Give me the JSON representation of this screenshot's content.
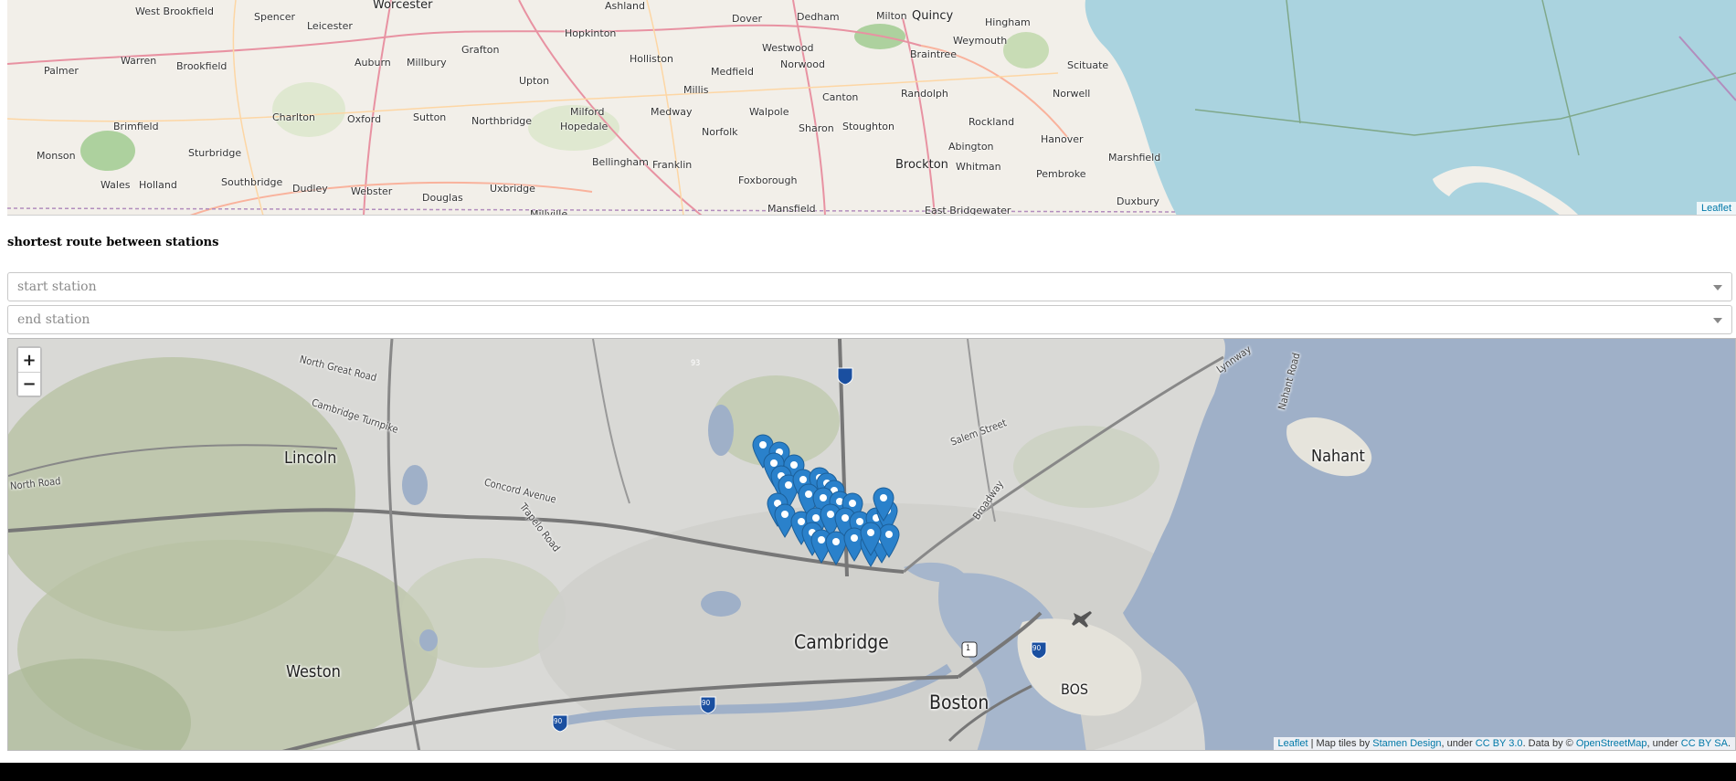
{
  "top_map": {
    "places": [
      {
        "name": "West Brookfield",
        "big": false
      },
      {
        "name": "Spencer",
        "big": false
      },
      {
        "name": "Leicester",
        "big": false
      },
      {
        "name": "Worcester",
        "big": true
      },
      {
        "name": "Ashland",
        "big": false
      },
      {
        "name": "Dover",
        "big": false
      },
      {
        "name": "Dedham",
        "big": false
      },
      {
        "name": "Milton",
        "big": false
      },
      {
        "name": "Quincy",
        "big": true
      },
      {
        "name": "Hingham",
        "big": false
      },
      {
        "name": "Palmer",
        "big": false
      },
      {
        "name": "Warren",
        "big": false
      },
      {
        "name": "Brookfield",
        "big": false
      },
      {
        "name": "Auburn",
        "big": false
      },
      {
        "name": "Millbury",
        "big": false
      },
      {
        "name": "Grafton",
        "big": false
      },
      {
        "name": "Hopkinton",
        "big": false
      },
      {
        "name": "Holliston",
        "big": false
      },
      {
        "name": "Medfield",
        "big": false
      },
      {
        "name": "Westwood",
        "big": false
      },
      {
        "name": "Norwood",
        "big": false
      },
      {
        "name": "Braintree",
        "big": false
      },
      {
        "name": "Weymouth",
        "big": false
      },
      {
        "name": "Scituate",
        "big": false
      },
      {
        "name": "Upton",
        "big": false
      },
      {
        "name": "Millis",
        "big": false
      },
      {
        "name": "Canton",
        "big": false
      },
      {
        "name": "Randolph",
        "big": false
      },
      {
        "name": "Norwell",
        "big": false
      },
      {
        "name": "Charlton",
        "big": false
      },
      {
        "name": "Oxford",
        "big": false
      },
      {
        "name": "Sutton",
        "big": false
      },
      {
        "name": "Northbridge",
        "big": false
      },
      {
        "name": "Hopedale",
        "big": false
      },
      {
        "name": "Milford",
        "big": false
      },
      {
        "name": "Medway",
        "big": false
      },
      {
        "name": "Walpole",
        "big": false
      },
      {
        "name": "Rockland",
        "big": false
      },
      {
        "name": "Monson",
        "big": false
      },
      {
        "name": "Brimfield",
        "big": false
      },
      {
        "name": "Sturbridge",
        "big": false
      },
      {
        "name": "Norfolk",
        "big": false
      },
      {
        "name": "Sharon",
        "big": false
      },
      {
        "name": "Stoughton",
        "big": false
      },
      {
        "name": "Abington",
        "big": false
      },
      {
        "name": "Hanover",
        "big": false
      },
      {
        "name": "Marshfield",
        "big": false
      },
      {
        "name": "Bellingham",
        "big": false
      },
      {
        "name": "Franklin",
        "big": false
      },
      {
        "name": "Brockton",
        "big": true
      },
      {
        "name": "Whitman",
        "big": false
      },
      {
        "name": "Wales",
        "big": false
      },
      {
        "name": "Holland",
        "big": false
      },
      {
        "name": "Southbridge",
        "big": false
      },
      {
        "name": "Dudley",
        "big": false
      },
      {
        "name": "Webster",
        "big": false
      },
      {
        "name": "Douglas",
        "big": false
      },
      {
        "name": "Uxbridge",
        "big": false
      },
      {
        "name": "Foxborough",
        "big": false
      },
      {
        "name": "Pembroke",
        "big": false
      },
      {
        "name": "Duxbury",
        "big": false
      },
      {
        "name": "Mansfield",
        "big": false
      },
      {
        "name": "East Bridgewater",
        "big": false
      },
      {
        "name": "Millville",
        "big": false
      }
    ],
    "attribution_link": "Leaflet"
  },
  "page": {
    "title": "shortest route between stations"
  },
  "inputs": {
    "start_placeholder": "start station",
    "end_placeholder": "end station"
  },
  "bottom_map": {
    "zoom_in": "+",
    "zoom_out": "−",
    "labels": [
      {
        "name": "Lincoln",
        "kind": "town"
      },
      {
        "name": "Weston",
        "kind": "town"
      },
      {
        "name": "Nahant",
        "kind": "town"
      },
      {
        "name": "Cambridge",
        "kind": "city"
      },
      {
        "name": "Boston",
        "kind": "city"
      },
      {
        "name": "BOS",
        "kind": "town"
      },
      {
        "name": "North Great Road",
        "kind": "small"
      },
      {
        "name": "Cambridge Turnpike",
        "kind": "small"
      },
      {
        "name": "North Road",
        "kind": "small"
      },
      {
        "name": "Concord Avenue",
        "kind": "small"
      },
      {
        "name": "Trapelo Road",
        "kind": "small"
      },
      {
        "name": "Salem Street",
        "kind": "small"
      },
      {
        "name": "Broadway",
        "kind": "small"
      },
      {
        "name": "Lynnway",
        "kind": "small"
      },
      {
        "name": "Nahant Road",
        "kind": "small"
      }
    ],
    "shields": [
      "93",
      "1",
      "90",
      "90",
      "90"
    ],
    "marker_count": 32,
    "attribution": {
      "leaflet": "Leaflet",
      "sep1": " | Map tiles by ",
      "stamen": "Stamen Design",
      "sep2": ", under ",
      "cc3": "CC BY 3.0",
      "sep3": ". Data by © ",
      "osm": "OpenStreetMap",
      "sep4": ", under ",
      "ccsa": "CC BY SA",
      "end": "."
    }
  },
  "colors": {
    "water": "#aad3df",
    "land": "#f2efe9",
    "marker": "#2a81cb",
    "link": "#0078a8",
    "ocean_stamen": "#9fb0c8"
  }
}
